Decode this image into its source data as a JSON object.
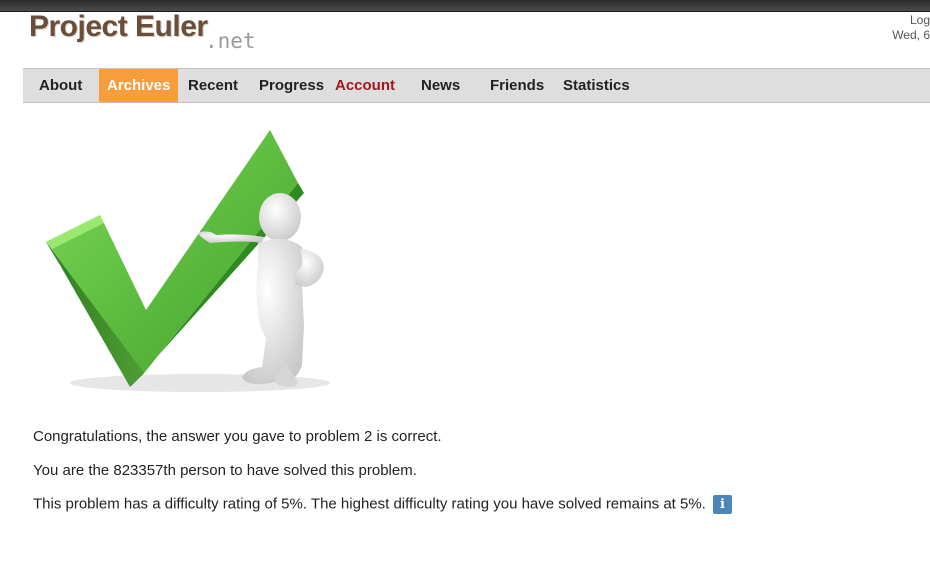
{
  "header": {
    "logo_text": "Project Euler",
    "logo_suffix": ".net",
    "login_text": "Log",
    "date_text": "Wed, 6"
  },
  "nav": {
    "items": [
      {
        "label": "About"
      },
      {
        "label": "Archives",
        "active": true
      },
      {
        "label": "Recent"
      },
      {
        "label": "Progress"
      },
      {
        "label": "Account"
      },
      {
        "label": "News"
      },
      {
        "label": "Friends"
      },
      {
        "label": "Statistics"
      }
    ]
  },
  "colors": {
    "logo": "#6b4e3a",
    "nav_active_bg": "#f89d3c",
    "account_link": "#a3171d",
    "checkmark_green": "#4cb833",
    "info_icon_bg": "#4c86b8"
  },
  "hero": {
    "icon": "checkmark-with-figure-illustration"
  },
  "main": {
    "message_correct": "Congratulations, the answer you gave to problem 2 is correct.",
    "message_solvers": "You are the 823357th person to have solved this problem.",
    "message_difficulty": "This problem has a difficulty rating of 5%. The highest difficulty rating you have solved remains at 5%.",
    "info_icon_glyph": "i"
  }
}
